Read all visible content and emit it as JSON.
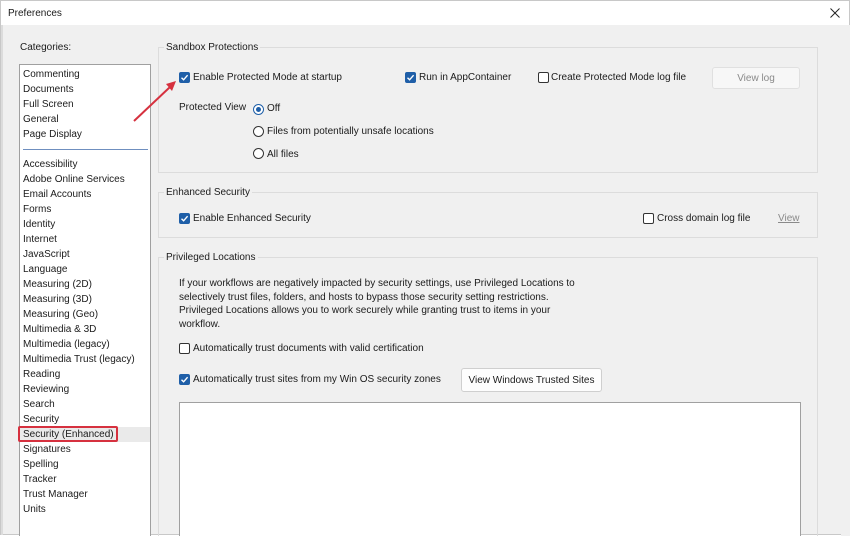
{
  "window": {
    "title": "Preferences"
  },
  "categories": {
    "label": "Categories:",
    "top_items": [
      "Commenting",
      "Documents",
      "Full Screen",
      "General",
      "Page Display"
    ],
    "items": [
      "Accessibility",
      "Adobe Online Services",
      "Email Accounts",
      "Forms",
      "Identity",
      "Internet",
      "JavaScript",
      "Language",
      "Measuring (2D)",
      "Measuring (3D)",
      "Measuring (Geo)",
      "Multimedia & 3D",
      "Multimedia (legacy)",
      "Multimedia Trust (legacy)",
      "Reading",
      "Reviewing",
      "Search",
      "Security",
      "Security (Enhanced)",
      "Signatures",
      "Spelling",
      "Tracker",
      "Trust Manager",
      "Units"
    ],
    "selected": "Security (Enhanced)"
  },
  "sandbox": {
    "title": "Sandbox Protections",
    "protected_mode_label": "Enable Protected Mode at startup",
    "protected_mode_checked": true,
    "appcontainer_label": "Run in AppContainer",
    "appcontainer_checked": true,
    "log_file_label": "Create Protected Mode log file",
    "log_file_checked": false,
    "view_log_label": "View log",
    "protected_view_label": "Protected View",
    "pv_off": "Off",
    "pv_unsafe": "Files from potentially unsafe locations",
    "pv_all": "All files",
    "pv_selected": "Off"
  },
  "enhanced": {
    "title": "Enhanced Security",
    "enable_label": "Enable Enhanced Security",
    "enable_checked": true,
    "cross_domain_label": "Cross domain log file",
    "cross_domain_checked": false,
    "view_label": "View"
  },
  "privileged": {
    "title": "Privileged Locations",
    "description": "If your workflows are negatively impacted by security settings, use Privileged Locations to selectively trust files, folders, and hosts to bypass those security setting restrictions. Privileged Locations allows you to work securely while granting trust to items in your workflow.",
    "trust_cert_label": "Automatically trust documents with valid certification",
    "trust_cert_checked": false,
    "trust_sites_label": "Automatically trust sites from my Win OS security zones",
    "trust_sites_checked": true,
    "view_trusted_label": "View Windows Trusted Sites"
  },
  "colors": {
    "accent": "#1f5fa8",
    "annotation_red": "#d6313f"
  }
}
